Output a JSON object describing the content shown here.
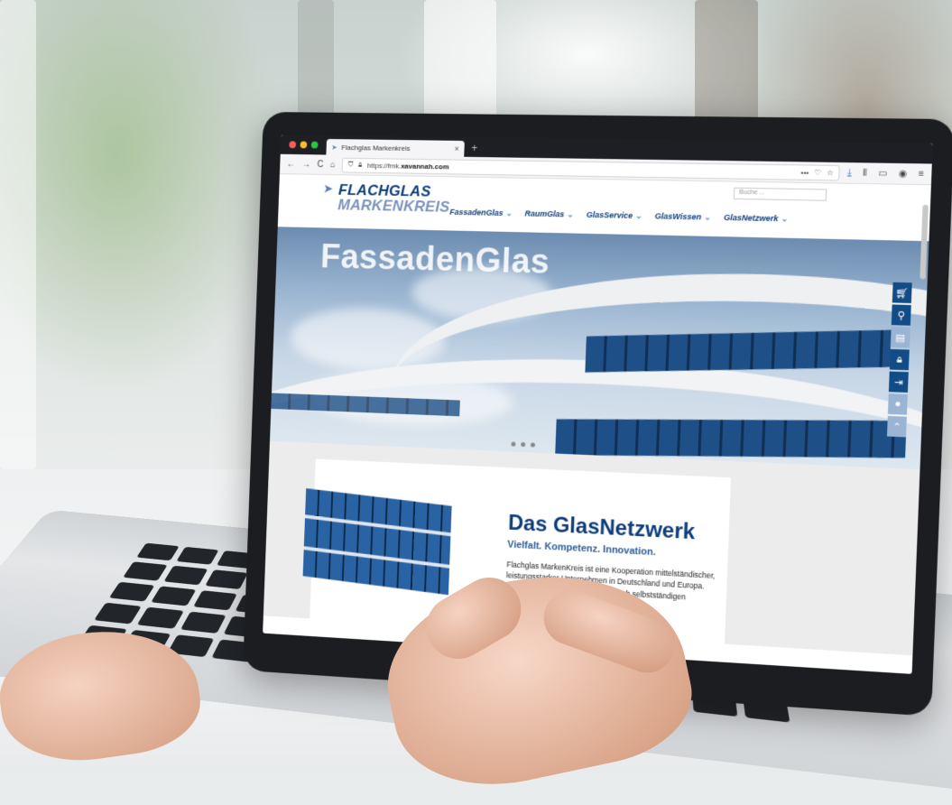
{
  "browser": {
    "tab_title": "Flachglas Markenkreis",
    "tab_close": "×",
    "new_tab": "+",
    "url_prefix": "https://fmk.",
    "url_domain": "xavannah.com",
    "nav_back": "←",
    "nav_forward": "→",
    "nav_reload": "C",
    "nav_home": "⌂",
    "menu_dots": "•••"
  },
  "site": {
    "logo_line1": "FLACHGLAS",
    "logo_line2": "MARKENKREIS",
    "search_placeholder": "Buche ...",
    "menu": [
      {
        "label": "FassadenGlas"
      },
      {
        "label": "RaumGlas"
      },
      {
        "label": "GlasService"
      },
      {
        "label": "GlasWissen"
      },
      {
        "label": "GlasNetzwerk"
      }
    ],
    "hero_title": "FassadenGlas",
    "card": {
      "title": "Das GlasNetzwerk",
      "subtitle": "Vielfalt. Kompetenz. Innovation.",
      "text": "Flachglas MarkenKreis ist eine Kooperation mittelständischer, leistungsstarker Unternehmen in Deutschland und Europa. Unsere juristisch und organisatorisch selbstständigen Mitglieder"
    },
    "sidebar_icons": [
      "cart-icon",
      "location-icon",
      "document-icon",
      "lock-icon",
      "login-icon",
      "user-icon",
      "scroll-top-icon"
    ]
  },
  "colors": {
    "brand_dark": "#0e3d7a",
    "brand_light": "#7a93bb",
    "sidebar": "#124c86"
  }
}
